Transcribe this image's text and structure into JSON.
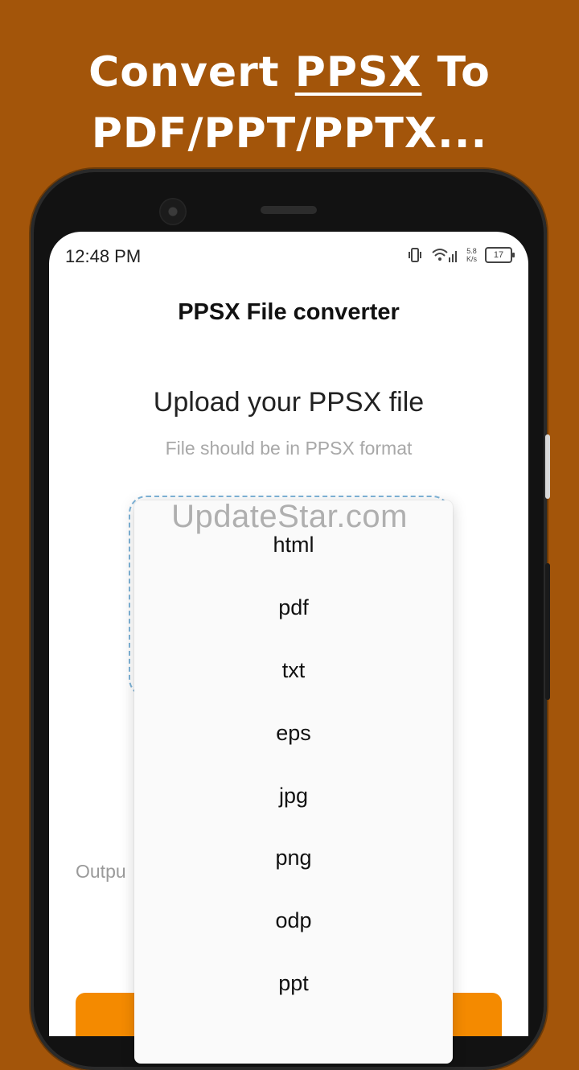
{
  "headline": {
    "line1_pre": "Convert ",
    "line1_highlight": "PPSX",
    "line1_post": " To",
    "line2": "PDF/PPT/PPTX..."
  },
  "status_bar": {
    "time": "12:48 PM",
    "net_speed_value": "5.8",
    "net_speed_unit": "K/s",
    "battery": "17"
  },
  "app": {
    "title": "PPSX File converter",
    "upload_title": "Upload your PPSX file",
    "upload_subtitle": "File should be in PPSX format",
    "output_label": "Outpu"
  },
  "dropdown": {
    "options": [
      "html",
      "pdf",
      "txt",
      "eps",
      "jpg",
      "png",
      "odp",
      "ppt"
    ]
  },
  "watermark": "UpdateStar.com",
  "colors": {
    "background": "#a3550a",
    "accent": "#f48a00",
    "dropzone_border": "#7fb4d8"
  }
}
